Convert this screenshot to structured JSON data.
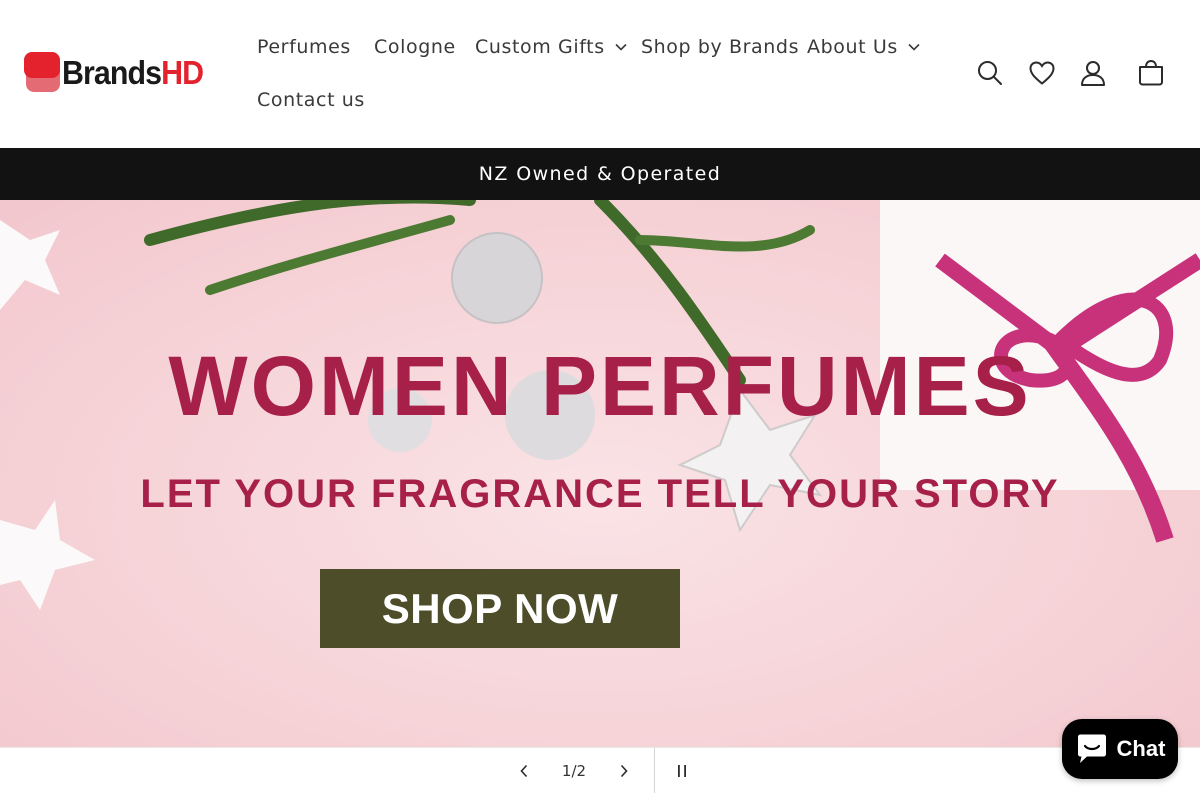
{
  "header": {
    "logo": {
      "text_main": "Brands",
      "text_accent": "HD",
      "colors": {
        "main": "#1a1a1a",
        "accent": "#e3222d"
      }
    },
    "nav": [
      {
        "label": "Perfumes",
        "has_dropdown": false
      },
      {
        "label": "Cologne",
        "has_dropdown": false
      },
      {
        "label": "Custom Gifts",
        "has_dropdown": true
      },
      {
        "label": "Shop by Brands",
        "has_dropdown": false
      },
      {
        "label": "About Us",
        "has_dropdown": true
      },
      {
        "label": "Contact us",
        "has_dropdown": false
      }
    ],
    "icons": [
      "search-icon",
      "heart-icon",
      "account-icon",
      "cart-icon"
    ]
  },
  "announcement": {
    "text": "NZ Owned & Operated"
  },
  "hero": {
    "title": "WOMEN PERFUMES",
    "subtitle": "LET YOUR FRAGRANCE TELL YOUR STORY",
    "cta_label": "SHOP NOW",
    "colors": {
      "text": "#a6204a",
      "cta_bg": "#4e4d2a",
      "background": "#f6d4d8"
    }
  },
  "slideshow": {
    "counter": "1/2",
    "icons": [
      "chevron-left-icon",
      "chevron-right-icon",
      "pause-icon"
    ]
  },
  "chat": {
    "label": "Chat",
    "icon": "chat-bubble-icon"
  }
}
